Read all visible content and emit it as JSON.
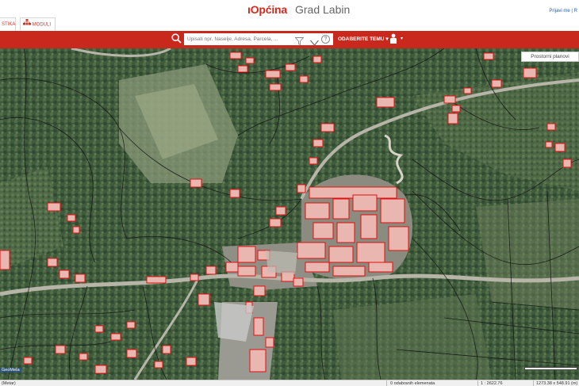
{
  "header": {
    "brand": "ıOpćina",
    "city": "Grad Labin",
    "login": "Prijavi me | R",
    "accent": "#c9281c"
  },
  "tabs": [
    {
      "label": "STIKA",
      "icon": "stats-icon"
    },
    {
      "label": "MODULI",
      "icon": "modules-icon"
    }
  ],
  "toolbar": {
    "search_placeholder": "Upisati npr. Naselje, Adresa, Parcela, ...",
    "help": "?",
    "theme_label": "ODABERITE TEMU",
    "theme_caret": "▾",
    "person_caret": "▾"
  },
  "map": {
    "plans_button": "Prostorni planovi",
    "attribution": "GeoMeta",
    "scale_hint": ""
  },
  "statusbar": {
    "units": "(Metar)",
    "selected": "0 odabranih elemenata",
    "scale": "1 : 2622.76",
    "extent": "1273.38 x 548.91 (m)"
  }
}
